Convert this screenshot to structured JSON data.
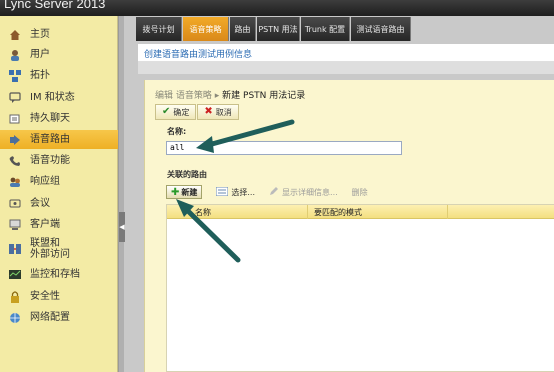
{
  "app": {
    "title": "Lync Server 2013"
  },
  "sidebar": {
    "items": [
      {
        "label": "主页",
        "icon": "home-icon"
      },
      {
        "label": "用户",
        "icon": "user-icon"
      },
      {
        "label": "拓扑",
        "icon": "topology-icon"
      },
      {
        "label": "IM 和状态",
        "icon": "im-presence-icon"
      },
      {
        "label": "持久聊天",
        "icon": "persistent-chat-icon"
      },
      {
        "label": "语音路由",
        "icon": "voice-routing-icon",
        "active": true
      },
      {
        "label": "语音功能",
        "icon": "phone-icon"
      },
      {
        "label": "响应组",
        "icon": "response-group-icon"
      },
      {
        "label": "会议",
        "icon": "conferencing-icon"
      },
      {
        "label": "客户端",
        "icon": "clients-icon"
      },
      {
        "label": "联盟和\n外部访问",
        "icon": "federation-icon"
      },
      {
        "label": "监控和存档",
        "icon": "monitoring-icon"
      },
      {
        "label": "安全性",
        "icon": "lock-icon"
      },
      {
        "label": "网络配置",
        "icon": "network-icon"
      }
    ]
  },
  "tabs": [
    {
      "label": "拨号计划"
    },
    {
      "label": "语音策略",
      "active": true
    },
    {
      "label": "路由"
    },
    {
      "label": "PSTN 用法"
    },
    {
      "label": "Trunk 配置"
    },
    {
      "label": "测试语音路由"
    }
  ],
  "subheader": {
    "link": "创建语音路由测试用例信息"
  },
  "breadcrumb": {
    "part1": "编辑 语音策略",
    "sep": "▸",
    "current": "新建 PSTN 用法记录"
  },
  "toolbar": {
    "ok": "确定",
    "cancel": "取消"
  },
  "form": {
    "name_label": "名称:",
    "name_value": "all",
    "routes_label": "关联的路由"
  },
  "routes_toolbar": {
    "new": "新建",
    "select": "选择...",
    "details": "显示详细信息...",
    "delete": "删除"
  },
  "grid": {
    "columns": [
      "名称",
      "要匹配的模式"
    ],
    "rows": []
  },
  "colors": {
    "accent": "#f0a020",
    "sidebar_bg": "#f3eba5",
    "active_nav": "#f0b52a",
    "arrow": "#1f5e5a"
  }
}
